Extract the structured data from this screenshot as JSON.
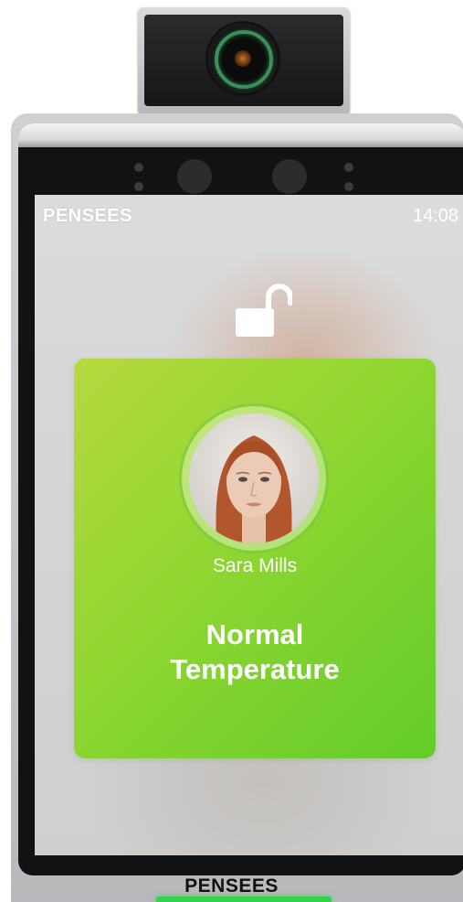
{
  "brand": {
    "logo_text": "PENSEES",
    "chin_logo_text": "PENSEES"
  },
  "status_bar": {
    "time": "14:08"
  },
  "recognition": {
    "lock_icon": "unlock-icon",
    "person_name": "Sara Mills",
    "status_line_1": "Normal",
    "status_line_2": "Temperature",
    "card_color": "#8fd631"
  },
  "hardware": {
    "led_color": "#35d24f",
    "lens_ring_color": "#3c8f59"
  }
}
